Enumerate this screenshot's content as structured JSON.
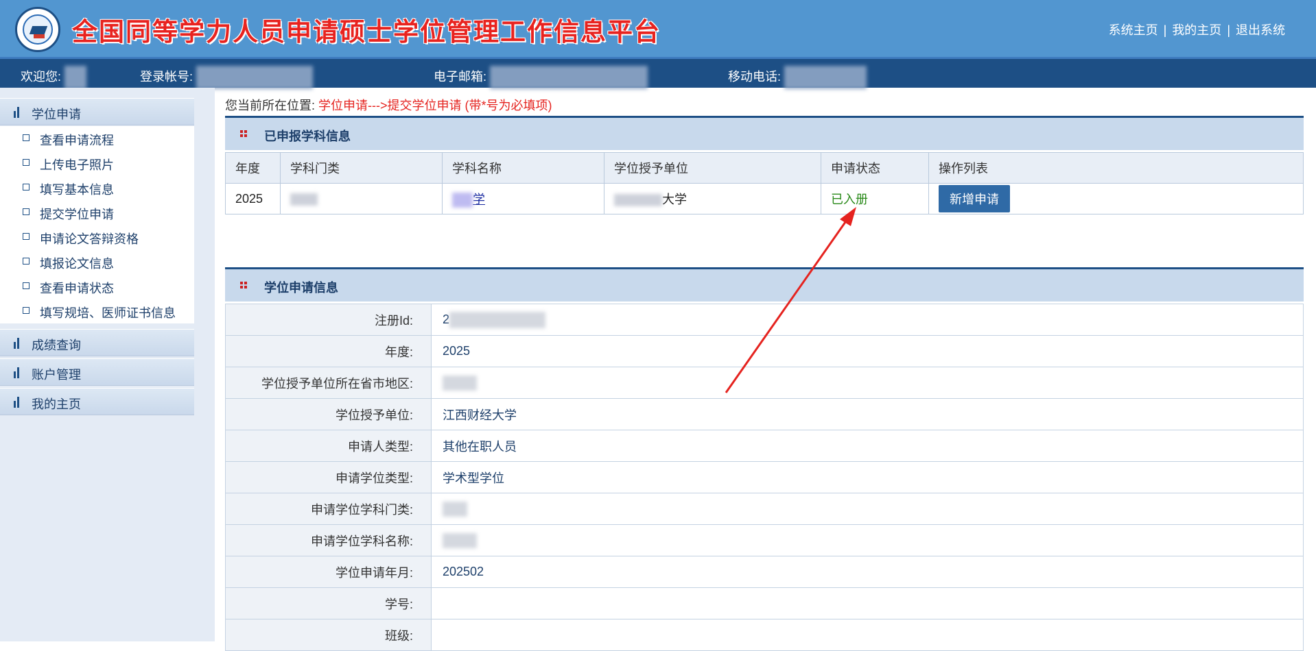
{
  "header": {
    "title": "全国同等学力人员申请硕士学位管理工作信息平台",
    "links": [
      "系统主页",
      "我的主页",
      "退出系统"
    ],
    "separator": "|"
  },
  "infobar": {
    "welcome_label": "欢迎您:",
    "account_label": "登录帐号:",
    "email_label": "电子邮箱:",
    "phone_label": "移动电话:"
  },
  "sidebar": {
    "groups": [
      {
        "label": "学位申请"
      },
      {
        "label": "成绩查询"
      },
      {
        "label": "账户管理"
      },
      {
        "label": "我的主页"
      }
    ],
    "sub_items": [
      {
        "label": "查看申请流程"
      },
      {
        "label": "上传电子照片"
      },
      {
        "label": "填写基本信息"
      },
      {
        "label": "提交学位申请"
      },
      {
        "label": "申请论文答辩资格"
      },
      {
        "label": "填报论文信息"
      },
      {
        "label": "查看申请状态"
      },
      {
        "label": "填写规培、医师证书信息"
      }
    ]
  },
  "breadcrumb": {
    "prefix": "您当前所在位置:",
    "path": "学位申请--->提交学位申请 (带*号为必填项)"
  },
  "subjects_panel": {
    "title": "已申报学科信息",
    "columns": [
      "年度",
      "学科门类",
      "学科名称",
      "学位授予单位",
      "申请状态",
      "操作列表"
    ],
    "row": {
      "year": "2025",
      "category": "",
      "subject_name": "学",
      "unit": "大学",
      "status": "已入册",
      "action": "新增申请"
    }
  },
  "application_panel": {
    "title": "学位申请信息",
    "rows": [
      {
        "label": "注册Id:",
        "value": "2"
      },
      {
        "label": "年度:",
        "value": "2025"
      },
      {
        "label": "学位授予单位所在省市地区:",
        "value": ""
      },
      {
        "label": "学位授予单位:",
        "value": "江西财经大学"
      },
      {
        "label": "申请人类型:",
        "value": "其他在职人员"
      },
      {
        "label": "申请学位类型:",
        "value": "学术型学位"
      },
      {
        "label": "申请学位学科门类:",
        "value": ""
      },
      {
        "label": "申请学位学科名称:",
        "value": ""
      },
      {
        "label": "学位申请年月:",
        "value": "202502"
      },
      {
        "label": "学号:",
        "value": ""
      },
      {
        "label": "班级:",
        "value": ""
      }
    ]
  },
  "colors": {
    "header_bg": "#5296d0",
    "infobar_bg": "#1d4f85",
    "title_red": "#e8231f",
    "status_green": "#2a8a1a",
    "button_blue": "#2f6aa6",
    "annotation_arrow": "#e5231f"
  }
}
